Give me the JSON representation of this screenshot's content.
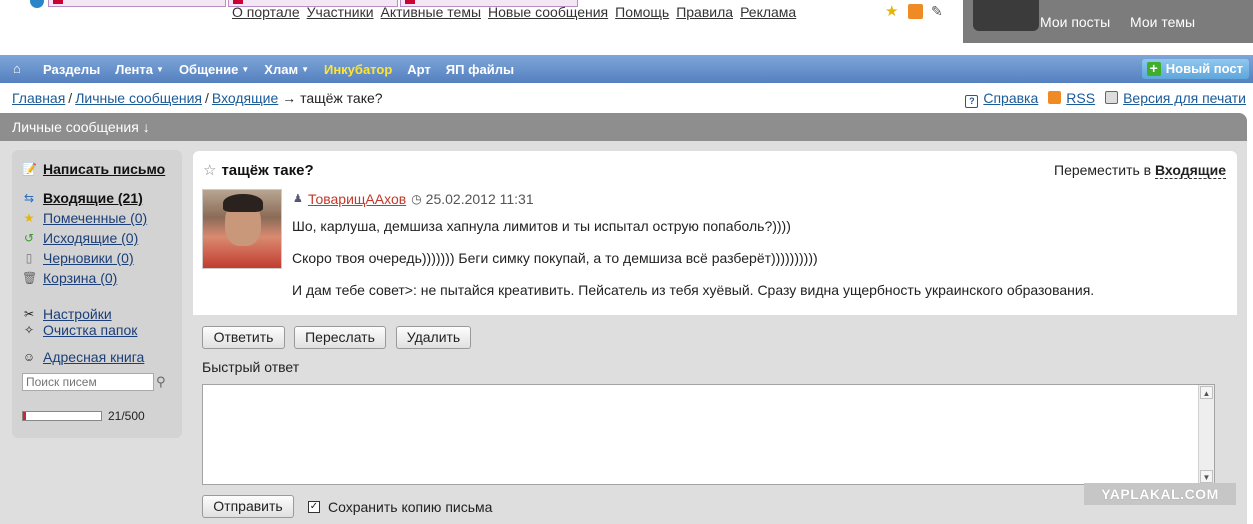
{
  "header": {
    "top_links": [
      "О портале",
      "Участники",
      "Активные темы",
      "Новые сообщения",
      "Помощь",
      "Правила",
      "Реклама"
    ],
    "user_links": [
      "Мои посты",
      "Мои темы"
    ]
  },
  "nav": {
    "items": [
      {
        "label": "Разделы",
        "caret": false,
        "highlight": false
      },
      {
        "label": "Лента",
        "caret": true,
        "highlight": false
      },
      {
        "label": "Общение",
        "caret": true,
        "highlight": false
      },
      {
        "label": "Хлам",
        "caret": true,
        "highlight": false
      },
      {
        "label": "Инкубатор",
        "caret": false,
        "highlight": true
      },
      {
        "label": "Арт",
        "caret": false,
        "highlight": false
      },
      {
        "label": "ЯП файлы",
        "caret": false,
        "highlight": false
      }
    ],
    "new_post": "Новый пост",
    "highlight_color": "#ffe531"
  },
  "breadcrumb": {
    "items": [
      "Главная",
      "Личные сообщения",
      "Входящие"
    ],
    "current": "тащёж таке?",
    "arrow": "→",
    "sep": "/"
  },
  "tools": {
    "help": "Справка",
    "rss": "RSS",
    "print": "Версия для печати"
  },
  "pm_header": "Личные сообщения ↓",
  "sidebar": {
    "compose": "Написать письмо",
    "folders": [
      {
        "label": "Входящие (21)",
        "icon": "inbox-icon",
        "bold": true
      },
      {
        "label": "Помеченные (0)",
        "icon": "star-icon",
        "bold": false
      },
      {
        "label": "Исходящие (0)",
        "icon": "outbox-icon",
        "bold": false
      },
      {
        "label": "Черновики (0)",
        "icon": "drafts-icon",
        "bold": false
      },
      {
        "label": "Корзина (0)",
        "icon": "trash-icon",
        "bold": false
      }
    ],
    "settings": "Настройки",
    "clean": "Очистка папок",
    "addressbook": "Адресная книга",
    "search_placeholder": "Поиск писем",
    "quota_text": "21/500",
    "quota_fraction": 0.042
  },
  "message": {
    "title": "тащёж таке?",
    "move_label": "Переместить в",
    "move_target": "Входящие",
    "author": "ТоварищААхов",
    "date": "25.02.2012 11:31",
    "lines": [
      "Шо, карлуша, демшиза хапнула лимитов и ты испытал острую попаболь?))))",
      "Скоро твоя очередь))))))) Беги симку покупай, а то демшиза всё разберёт))))))))))",
      "И дам тебе совет>: не пытайся креативить. Пейсатель из тебя хуёвый. Сразу видна ущербность украинского образования."
    ]
  },
  "actions": {
    "reply": "Ответить",
    "forward": "Переслать",
    "delete": "Удалить",
    "quick_reply": "Быстрый ответ",
    "send": "Отправить",
    "keep_copy": "Сохранить копию письма"
  },
  "watermark": "YAPLAKAL.COM"
}
